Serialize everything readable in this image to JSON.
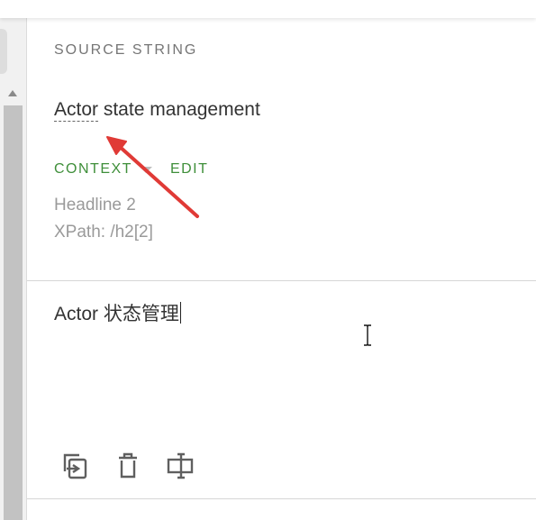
{
  "source": {
    "section_label": "SOURCE STRING",
    "term": "Actor",
    "rest": " state management",
    "context_label": "CONTEXT",
    "edit_label": "EDIT",
    "meta_1": "Headline 2",
    "meta_2": "XPath: /h2[2]"
  },
  "translation": {
    "value": "Actor 状态管理"
  },
  "toolbar": {
    "icons": [
      "copy-source-icon",
      "delete-icon",
      "insert-icon"
    ]
  },
  "colors": {
    "accent_green": "#3f8f3a",
    "annotation_arrow": "#e03a36",
    "muted_text": "#9a9a9a"
  }
}
